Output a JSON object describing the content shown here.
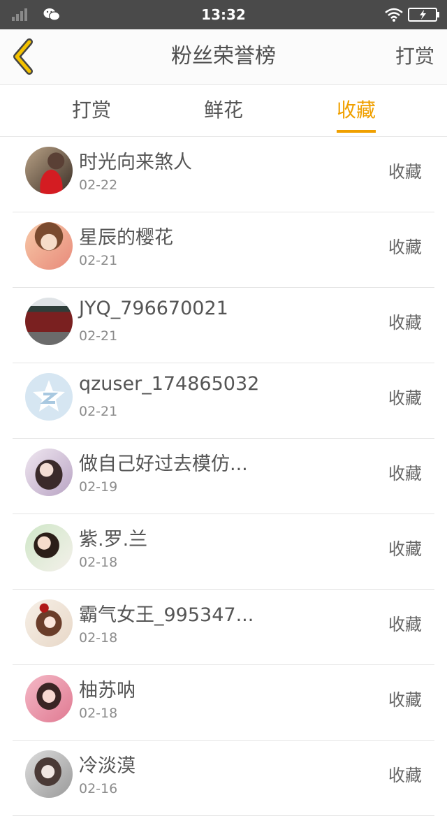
{
  "status_bar": {
    "time": "13:32"
  },
  "nav": {
    "title": "粉丝荣誉榜",
    "action": "打赏"
  },
  "tabs": [
    {
      "label": "打赏",
      "active": false
    },
    {
      "label": "鲜花",
      "active": false
    },
    {
      "label": "收藏",
      "active": true
    }
  ],
  "accent_color": "#f0a000",
  "fans": [
    {
      "name": "时光向来煞人",
      "date": "02-22",
      "type": "收藏"
    },
    {
      "name": "星辰的樱花",
      "date": "02-21",
      "type": "收藏"
    },
    {
      "name": "JYQ_796670021",
      "date": "02-21",
      "type": "收藏"
    },
    {
      "name": "qzuser_174865032",
      "date": "02-21",
      "type": "收藏"
    },
    {
      "name": "做自己好过去模仿...",
      "date": "02-19",
      "type": "收藏"
    },
    {
      "name": "紫.罗.兰",
      "date": "02-18",
      "type": "收藏"
    },
    {
      "name": "霸气女王_995347...",
      "date": "02-18",
      "type": "收藏"
    },
    {
      "name": "柚苏呐",
      "date": "02-18",
      "type": "收藏"
    },
    {
      "name": "冷淡漠",
      "date": "02-16",
      "type": "收藏"
    }
  ]
}
